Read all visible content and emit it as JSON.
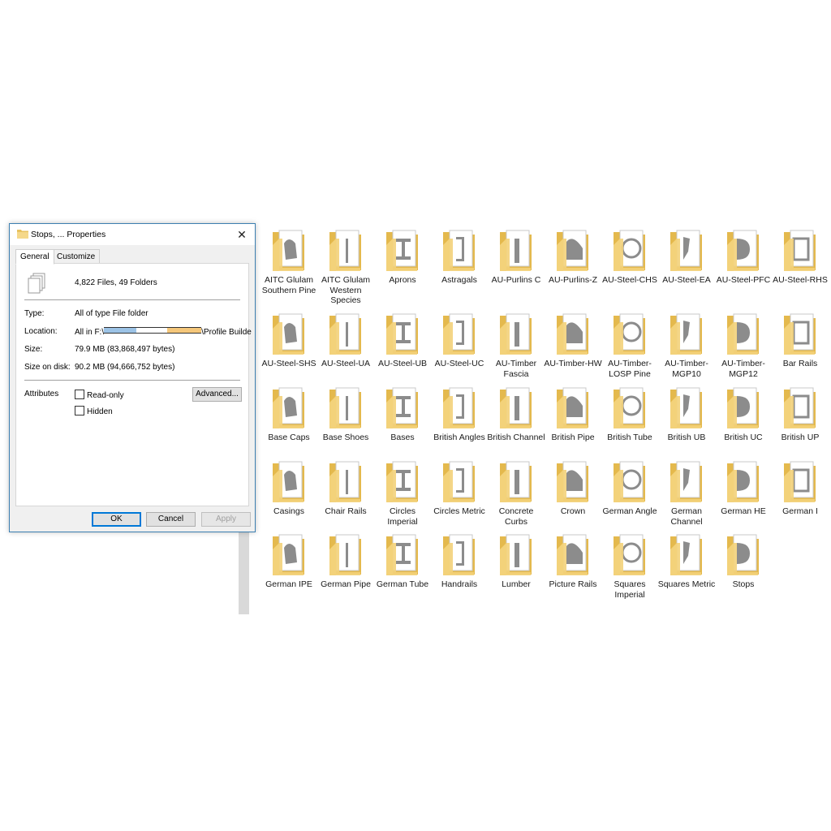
{
  "dialog": {
    "title": "Stops, ... Properties",
    "tabs": [
      "General",
      "Customize"
    ],
    "summary": "4,822 Files, 49 Folders",
    "type_label": "Type:",
    "type_value": "All of type File folder",
    "location_label": "Location:",
    "location_prefix": "All in F:\\",
    "location_suffix": "\\Profile Builde",
    "size_label": "Size:",
    "size_value": "79.9 MB (83,868,497 bytes)",
    "size_on_disk_label": "Size on disk:",
    "size_on_disk_value": "90.2 MB (94,666,752 bytes)",
    "attributes_label": "Attributes",
    "readonly_label": "Read-only",
    "hidden_label": "Hidden",
    "advanced_button": "Advanced...",
    "ok_button": "OK",
    "cancel_button": "Cancel",
    "apply_button": "Apply",
    "close_glyph": "✕"
  },
  "folders": [
    "AITC Glulam Southern Pine",
    "AITC Glulam Western Species",
    "Aprons",
    "Astragals",
    "AU-Purlins C",
    "AU-Purlins-Z",
    "AU-Steel-CHS",
    "AU-Steel-EA",
    "AU-Steel-PFC",
    "AU-Steel-RHS",
    "AU-Steel-SHS",
    "AU-Steel-UA",
    "AU-Steel-UB",
    "AU-Steel-UC",
    "AU-Timber Fascia",
    "AU-Timber-HW",
    "AU-Timber-LOSP Pine",
    "AU-Timber-MGP10",
    "AU-Timber-MGP12",
    "Bar Rails",
    "Base Caps",
    "Base Shoes",
    "Bases",
    "British Angles",
    "British Channel",
    "British Pipe",
    "British Tube",
    "British UB",
    "British UC",
    "British UP",
    "Casings",
    "Chair Rails",
    "Circles Imperial",
    "Circles Metric",
    "Concrete Curbs",
    "Crown",
    "German Angle",
    "German Channel",
    "German HE",
    "German I",
    "German IPE",
    "German Pipe",
    "German Tube",
    "Handrails",
    "Lumber",
    "Picture Rails",
    "Squares Imperial",
    "Squares Metric",
    "Stops"
  ],
  "colors": {
    "folder": "#f3d27a",
    "folder_dark": "#e4b94d",
    "shape": "#8c8c8c",
    "accent": "#0078d7"
  }
}
